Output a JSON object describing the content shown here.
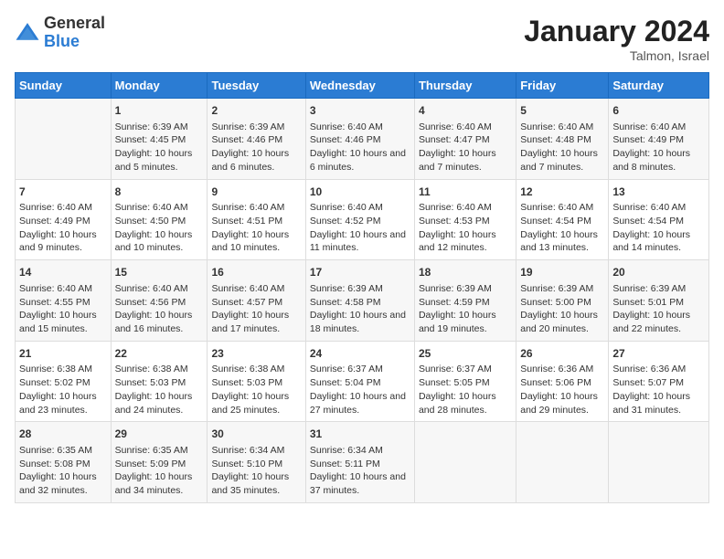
{
  "header": {
    "logo_line1": "General",
    "logo_line2": "Blue",
    "month_title": "January 2024",
    "location": "Talmon, Israel"
  },
  "days_of_week": [
    "Sunday",
    "Monday",
    "Tuesday",
    "Wednesday",
    "Thursday",
    "Friday",
    "Saturday"
  ],
  "weeks": [
    [
      {
        "day": "",
        "content": ""
      },
      {
        "day": "1",
        "content": "Sunrise: 6:39 AM\nSunset: 4:45 PM\nDaylight: 10 hours and 5 minutes."
      },
      {
        "day": "2",
        "content": "Sunrise: 6:39 AM\nSunset: 4:46 PM\nDaylight: 10 hours and 6 minutes."
      },
      {
        "day": "3",
        "content": "Sunrise: 6:40 AM\nSunset: 4:46 PM\nDaylight: 10 hours and 6 minutes."
      },
      {
        "day": "4",
        "content": "Sunrise: 6:40 AM\nSunset: 4:47 PM\nDaylight: 10 hours and 7 minutes."
      },
      {
        "day": "5",
        "content": "Sunrise: 6:40 AM\nSunset: 4:48 PM\nDaylight: 10 hours and 7 minutes."
      },
      {
        "day": "6",
        "content": "Sunrise: 6:40 AM\nSunset: 4:49 PM\nDaylight: 10 hours and 8 minutes."
      }
    ],
    [
      {
        "day": "7",
        "content": "Sunrise: 6:40 AM\nSunset: 4:49 PM\nDaylight: 10 hours and 9 minutes."
      },
      {
        "day": "8",
        "content": "Sunrise: 6:40 AM\nSunset: 4:50 PM\nDaylight: 10 hours and 10 minutes."
      },
      {
        "day": "9",
        "content": "Sunrise: 6:40 AM\nSunset: 4:51 PM\nDaylight: 10 hours and 10 minutes."
      },
      {
        "day": "10",
        "content": "Sunrise: 6:40 AM\nSunset: 4:52 PM\nDaylight: 10 hours and 11 minutes."
      },
      {
        "day": "11",
        "content": "Sunrise: 6:40 AM\nSunset: 4:53 PM\nDaylight: 10 hours and 12 minutes."
      },
      {
        "day": "12",
        "content": "Sunrise: 6:40 AM\nSunset: 4:54 PM\nDaylight: 10 hours and 13 minutes."
      },
      {
        "day": "13",
        "content": "Sunrise: 6:40 AM\nSunset: 4:54 PM\nDaylight: 10 hours and 14 minutes."
      }
    ],
    [
      {
        "day": "14",
        "content": "Sunrise: 6:40 AM\nSunset: 4:55 PM\nDaylight: 10 hours and 15 minutes."
      },
      {
        "day": "15",
        "content": "Sunrise: 6:40 AM\nSunset: 4:56 PM\nDaylight: 10 hours and 16 minutes."
      },
      {
        "day": "16",
        "content": "Sunrise: 6:40 AM\nSunset: 4:57 PM\nDaylight: 10 hours and 17 minutes."
      },
      {
        "day": "17",
        "content": "Sunrise: 6:39 AM\nSunset: 4:58 PM\nDaylight: 10 hours and 18 minutes."
      },
      {
        "day": "18",
        "content": "Sunrise: 6:39 AM\nSunset: 4:59 PM\nDaylight: 10 hours and 19 minutes."
      },
      {
        "day": "19",
        "content": "Sunrise: 6:39 AM\nSunset: 5:00 PM\nDaylight: 10 hours and 20 minutes."
      },
      {
        "day": "20",
        "content": "Sunrise: 6:39 AM\nSunset: 5:01 PM\nDaylight: 10 hours and 22 minutes."
      }
    ],
    [
      {
        "day": "21",
        "content": "Sunrise: 6:38 AM\nSunset: 5:02 PM\nDaylight: 10 hours and 23 minutes."
      },
      {
        "day": "22",
        "content": "Sunrise: 6:38 AM\nSunset: 5:03 PM\nDaylight: 10 hours and 24 minutes."
      },
      {
        "day": "23",
        "content": "Sunrise: 6:38 AM\nSunset: 5:03 PM\nDaylight: 10 hours and 25 minutes."
      },
      {
        "day": "24",
        "content": "Sunrise: 6:37 AM\nSunset: 5:04 PM\nDaylight: 10 hours and 27 minutes."
      },
      {
        "day": "25",
        "content": "Sunrise: 6:37 AM\nSunset: 5:05 PM\nDaylight: 10 hours and 28 minutes."
      },
      {
        "day": "26",
        "content": "Sunrise: 6:36 AM\nSunset: 5:06 PM\nDaylight: 10 hours and 29 minutes."
      },
      {
        "day": "27",
        "content": "Sunrise: 6:36 AM\nSunset: 5:07 PM\nDaylight: 10 hours and 31 minutes."
      }
    ],
    [
      {
        "day": "28",
        "content": "Sunrise: 6:35 AM\nSunset: 5:08 PM\nDaylight: 10 hours and 32 minutes."
      },
      {
        "day": "29",
        "content": "Sunrise: 6:35 AM\nSunset: 5:09 PM\nDaylight: 10 hours and 34 minutes."
      },
      {
        "day": "30",
        "content": "Sunrise: 6:34 AM\nSunset: 5:10 PM\nDaylight: 10 hours and 35 minutes."
      },
      {
        "day": "31",
        "content": "Sunrise: 6:34 AM\nSunset: 5:11 PM\nDaylight: 10 hours and 37 minutes."
      },
      {
        "day": "",
        "content": ""
      },
      {
        "day": "",
        "content": ""
      },
      {
        "day": "",
        "content": ""
      }
    ]
  ]
}
